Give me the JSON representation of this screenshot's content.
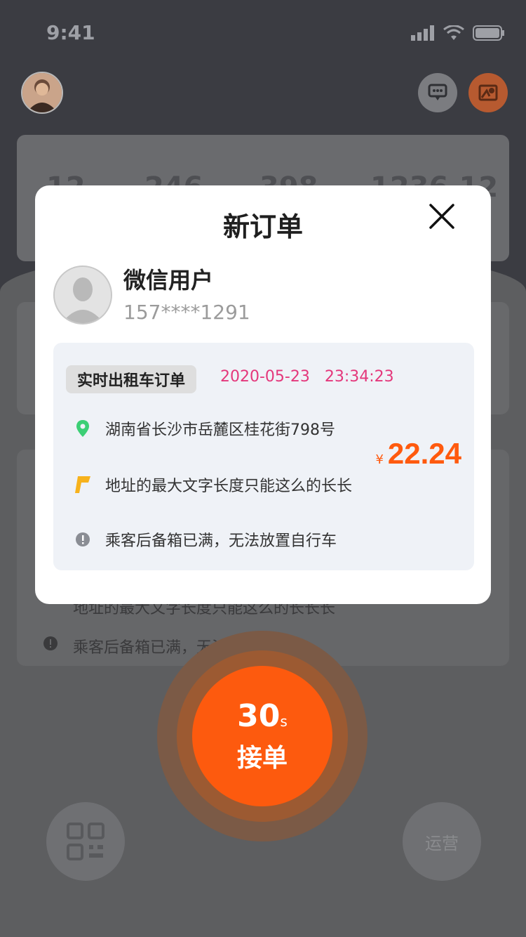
{
  "status_bar": {
    "time": "9:41"
  },
  "background": {
    "stats": [
      "12",
      "246",
      "398",
      "1236.12"
    ],
    "lower_rows": [
      "地址的最大文字长度只能这么的长长长",
      "乘客后备箱已满，无法放置自行车"
    ],
    "operations_label": "运营"
  },
  "modal": {
    "title": "新订单",
    "user": {
      "name": "微信用户",
      "phone": "157****1291"
    },
    "order": {
      "tag": "实时出租车订单",
      "date": "2020-05-23",
      "time": "23:34:23",
      "from": "湖南省长沙市岳麓区桂花街798号",
      "to": "地址的最大文字长度只能这么的长长",
      "note": "乘客后备箱已满，无法放置自行车",
      "price_currency": "¥",
      "price": "22.24"
    }
  },
  "accept": {
    "countdown": "30",
    "unit": "s",
    "label": "接单"
  },
  "colors": {
    "accent": "#fd5a0e",
    "date_pink": "#e4377b",
    "from_green": "#3ccf75",
    "to_yellow": "#f7b21c"
  }
}
